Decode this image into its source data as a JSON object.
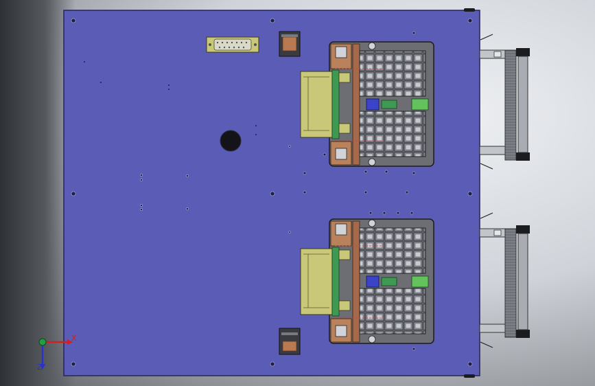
{
  "viewport": {
    "background": "#d8dbe0"
  },
  "model": {
    "plate_color": "#5b5cb5",
    "plate_edge": "#23245a",
    "fixture_frame": "#6c6e74",
    "connector_color": "#c9c878",
    "pcb_green": "#3e9a52",
    "wood_color": "#b9825c",
    "slot_color": "#8e9099",
    "handle_color": "#8d9197"
  },
  "triad": {
    "x_label": "X",
    "z_label": "Z",
    "x_color": "#d02020",
    "y_color": "#20a040",
    "z_color": "#2a30d0"
  }
}
